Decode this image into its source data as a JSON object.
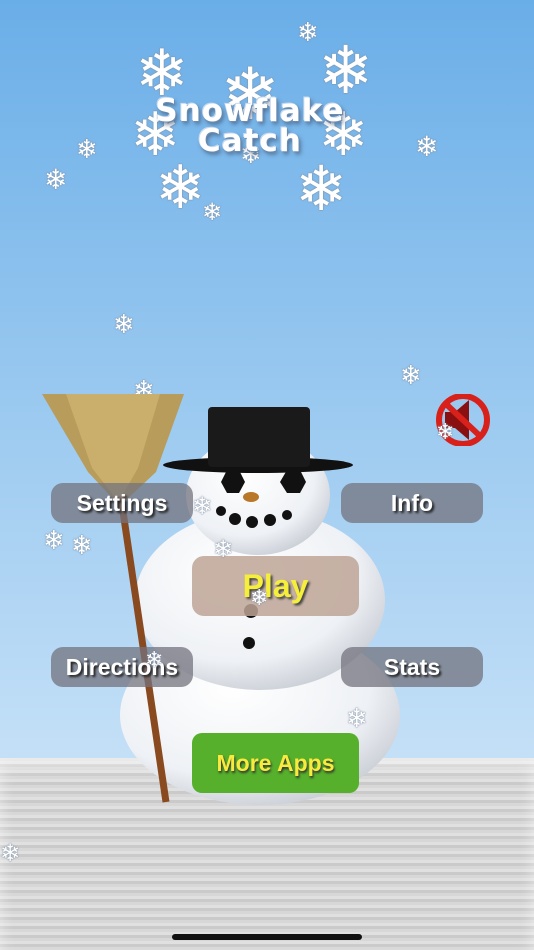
{
  "title": {
    "line1": "Snowflake",
    "line2": "Catch"
  },
  "buttons": {
    "settings": "Settings",
    "info": "Info",
    "play": "Play",
    "directions": "Directions",
    "stats": "Stats",
    "more_apps": "More Apps"
  },
  "icons": {
    "sound": "mute-speaker-icon",
    "flake": "snowflake-icon",
    "snowman": "snowman-illustration",
    "broom": "broom-illustration"
  },
  "colors": {
    "sky_top": "#6aaee8",
    "play_text": "#f6ef3a",
    "more_apps_bg": "#56b02b",
    "mute_red": "#d8211a"
  }
}
